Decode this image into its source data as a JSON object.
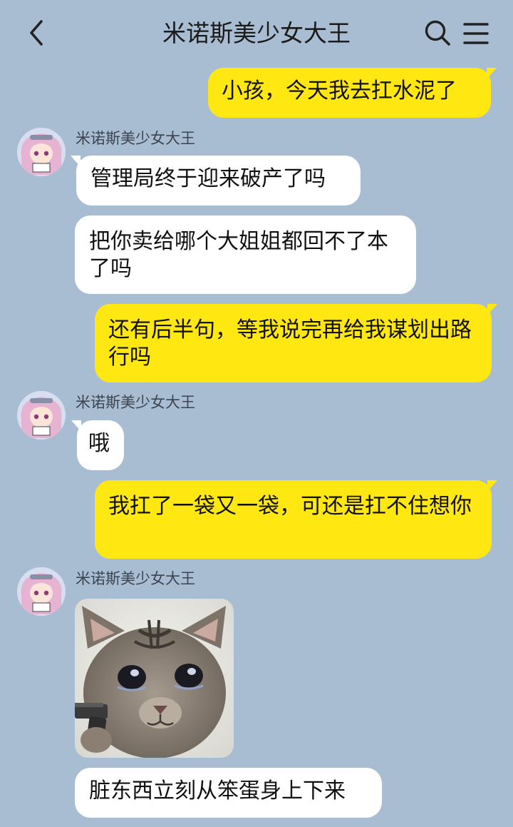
{
  "header": {
    "title": "米诺斯美少女大王",
    "back_icon": "chevron-left-icon",
    "search_icon": "search-icon",
    "menu_icon": "menu-icon"
  },
  "colors": {
    "background": "#a9bdd2",
    "outgoing_bubble": "#ffe812",
    "incoming_bubble": "#ffffff"
  },
  "messages": [
    {
      "direction": "out",
      "text": "小孩，今天我去扛水泥了"
    },
    {
      "direction": "in",
      "sender": "米诺斯美少女大王",
      "text": "管理局终于迎来破产了吗"
    },
    {
      "direction": "in",
      "text": "把你卖给哪个大姐姐都回不了本了吗"
    },
    {
      "direction": "out",
      "text": "还有后半句，等我说完再给我谋划出路行吗"
    },
    {
      "direction": "in",
      "sender": "米诺斯美少女大王",
      "text": "哦"
    },
    {
      "direction": "out",
      "text": "我扛了一袋又一袋，可还是扛不住想你"
    },
    {
      "direction": "in",
      "sender": "米诺斯美少女大王",
      "type": "image",
      "image_description": "kitten-with-pistol-sticker"
    },
    {
      "direction": "in",
      "text": "脏东西立刻从笨蛋身上下来"
    }
  ]
}
